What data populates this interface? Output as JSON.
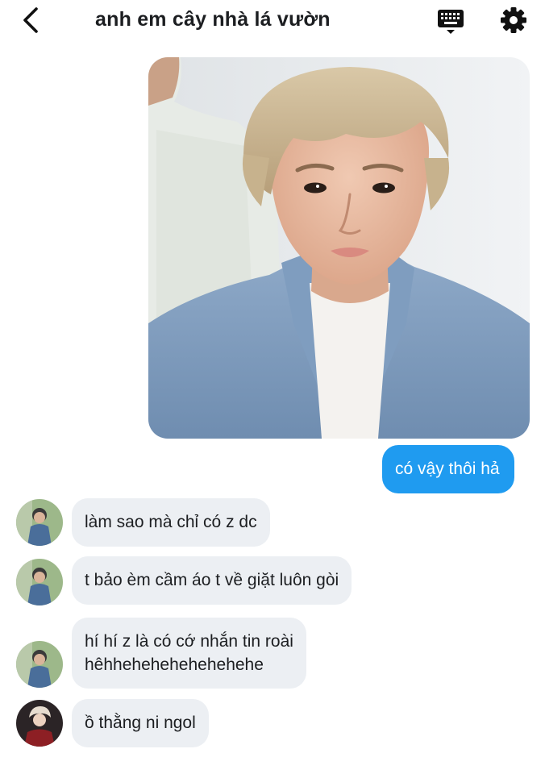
{
  "header": {
    "title": "anh em cây nhà lá vườn",
    "back_icon": "chevron-left-icon",
    "keyboard_icon": "keyboard-icon",
    "settings_icon": "gear-icon"
  },
  "messages": [
    {
      "direction": "outgoing",
      "text": "có vậy thôi hả"
    },
    {
      "direction": "incoming",
      "text": "làm sao mà chỉ có z dc"
    },
    {
      "direction": "incoming",
      "text": "t bảo èm cầm áo t về giặt luôn gòi"
    },
    {
      "direction": "incoming",
      "lines": [
        "hí hí z là có cớ nhắn tin roài",
        "hêhhehehehehehehehe"
      ]
    },
    {
      "direction": "incoming",
      "text": "ồ thằng ni ngol"
    }
  ],
  "colors": {
    "outgoing_bubble": "#1f9bf0",
    "incoming_bubble": "#eceff3",
    "text": "#1c1e21"
  }
}
